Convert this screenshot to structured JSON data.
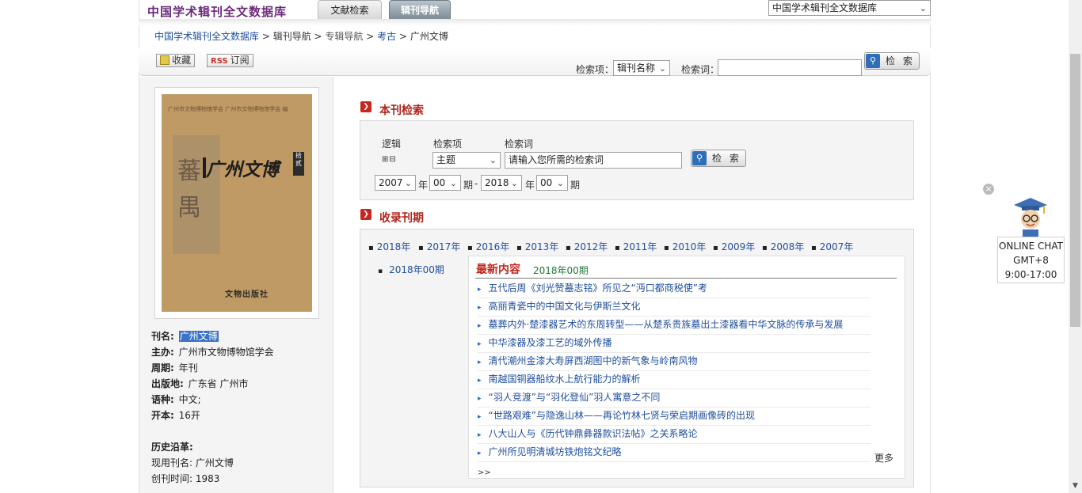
{
  "header": {
    "site_title": "中国学术辑刊全文数据库",
    "tabs": [
      {
        "label": "文献检索"
      },
      {
        "label": "辑刊导航"
      }
    ],
    "db_select": "中国学术辑刊全文数据库"
  },
  "breadcrumb": {
    "home": "中国学术辑刊全文数据库",
    "sep": " > ",
    "nav": "辑刊导航",
    "special": "专辑导航",
    "category": "考古",
    "current": "广州文博"
  },
  "toolbar": {
    "favorite": "收藏",
    "rss_tag": "RSS",
    "subscribe": "订阅",
    "field_label": "检索项：",
    "field_value": "辑刊名称",
    "term_label": "检索词：",
    "term_value": "",
    "search": "检 索"
  },
  "cover": {
    "top_text": "广州市文物博物馆学会  广州市文物博物馆学会 编",
    "char1": "蕃",
    "char2": "禺",
    "title": "广州文博",
    "tag": "拾贰",
    "publisher": "文物出版社"
  },
  "journal": {
    "name_label": "刊名:",
    "name": "广州文博",
    "sponsor_label": "主办:",
    "sponsor": "广州市文物博物馆学会",
    "period_label": "周期:",
    "period": "年刊",
    "place_label": "出版地:",
    "place": "广东省 广州市",
    "lang_label": "语种:",
    "lang": "中文;",
    "format_label": "开本:",
    "format": "16开",
    "history_label": "历史沿革:",
    "current_name_label": "现用刊名:",
    "current_name": "广州文博",
    "founded_label": "创刊时间:",
    "founded": "1983"
  },
  "search_panel": {
    "title": "本刊检索",
    "logic_label": "逻辑",
    "field_label": "检索项",
    "term_label": "检索词",
    "pm": "⊞⊟",
    "field_value": "主题",
    "term_placeholder": "请输入您所需的检索词",
    "search": "检 索",
    "from_year": "2007",
    "year_label": "年",
    "from_issue": "00",
    "issue_label": "期",
    "dash": "-",
    "to_year": "2018",
    "to_issue": "00"
  },
  "issues_panel": {
    "title": "收录刊期",
    "years": [
      "2018年",
      "2017年",
      "2016年",
      "2013年",
      "2012年",
      "2011年",
      "2010年",
      "2009年",
      "2008年",
      "2007年"
    ],
    "issue": "2018年00期",
    "latest_title": "最新内容",
    "latest_issue": "2018年00期",
    "articles": [
      "五代后周《刘光赞墓志铭》所见之“沔口都商税使”考",
      "高丽青瓷中的中国文化与伊斯兰文化",
      "墓葬内外·楚漆器艺术的东周转型——从楚系贵族墓出土漆器看中华文脉的传承与发展",
      "中华漆器及漆工艺的域外传播",
      "清代潮州金漆大寿屏西湖图中的新气象与岭南风物",
      "南越国铜器船纹水上航行能力的解析",
      "“羽人竞渡”与“羽化登仙”羽人寓意之不同",
      "“世路艰难”与隐逸山林——再论竹林七贤与荣启期画像砖的出现",
      "八大山人与《历代钟鼎彝器款识法帖》之关系略论",
      "广州所见明清城坊铁炮铭文纪略"
    ],
    "more": "更多",
    "chevrons": ">>"
  },
  "chat": {
    "line1": "ONLINE CHAT",
    "line2": "GMT+8",
    "line3": "9:00-17:00",
    "close": "×"
  },
  "colors": {
    "brand": "#6b2a7a",
    "accent_red": "#b0261c",
    "link_blue": "#1f4e9c",
    "issue_green": "#1e7a3a"
  },
  "icons": [
    "favorite-icon",
    "rss-icon",
    "search-icon",
    "section-arrow-icon",
    "close-icon",
    "tutor-avatar-icon"
  ]
}
